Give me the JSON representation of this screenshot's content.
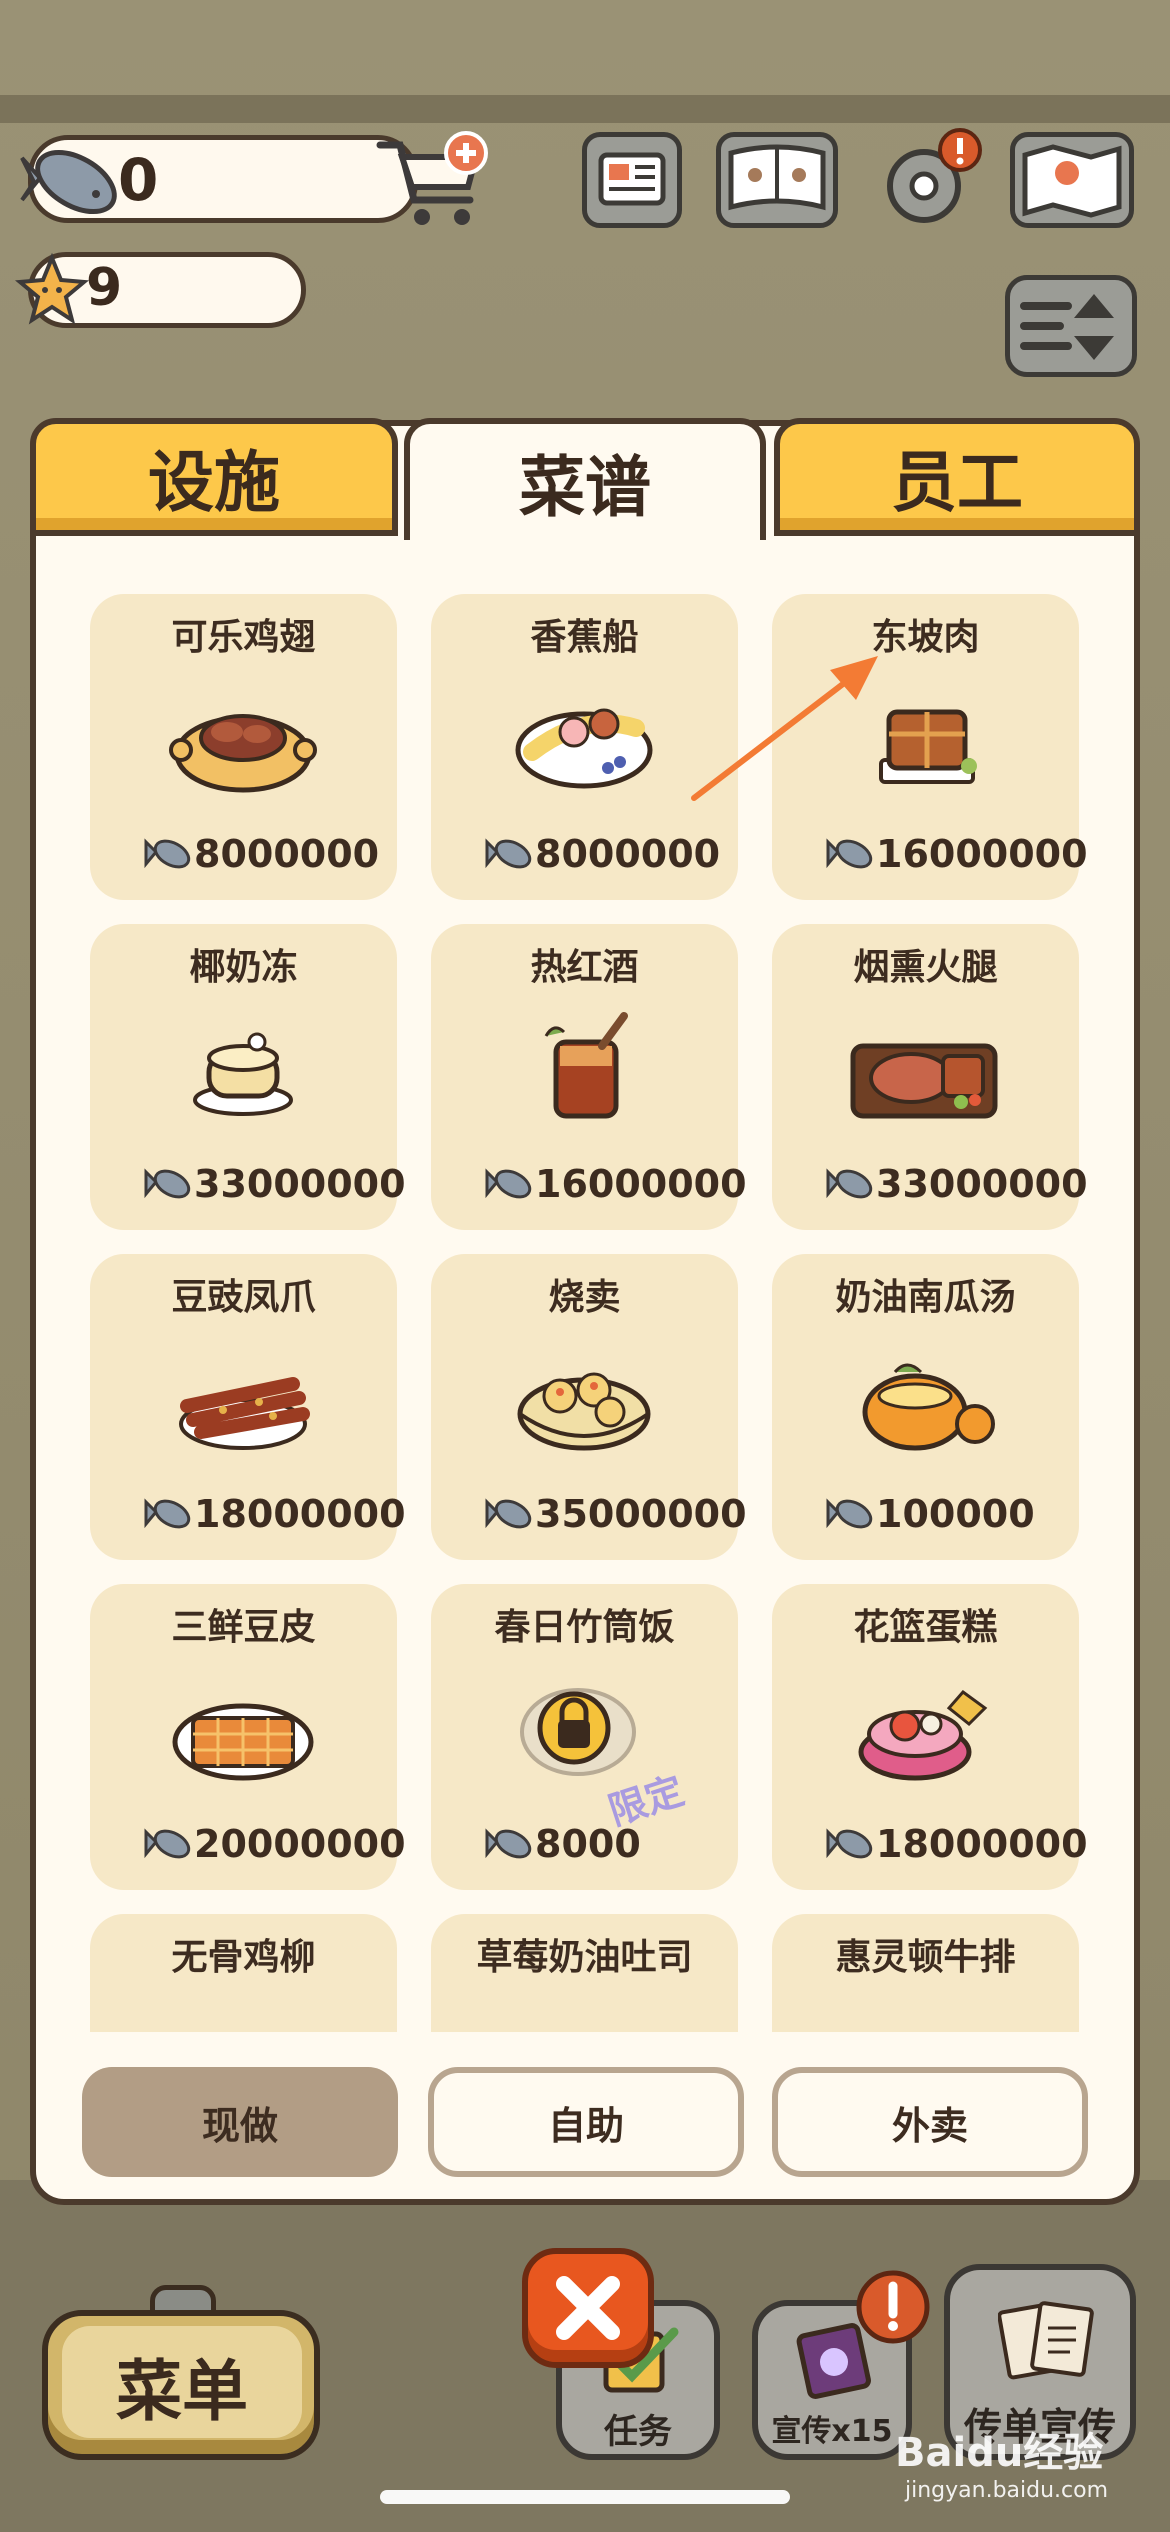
{
  "hud": {
    "fish_count": "0",
    "star_count": "9"
  },
  "tabs": [
    {
      "label": "设施",
      "active": false
    },
    {
      "label": "菜谱",
      "active": true
    },
    {
      "label": "员工",
      "active": false
    }
  ],
  "recipes": [
    {
      "name": "可乐鸡翅",
      "price": "8000000"
    },
    {
      "name": "香蕉船",
      "price": "8000000"
    },
    {
      "name": "东坡肉",
      "price": "16000000"
    },
    {
      "name": "椰奶冻",
      "price": "33000000"
    },
    {
      "name": "热红酒",
      "price": "16000000"
    },
    {
      "name": "烟熏火腿",
      "price": "33000000"
    },
    {
      "name": "豆豉凤爪",
      "price": "18000000"
    },
    {
      "name": "烧卖",
      "price": "35000000"
    },
    {
      "name": "奶油南瓜汤",
      "price": "100000"
    },
    {
      "name": "三鲜豆皮",
      "price": "20000000"
    },
    {
      "name": "春日竹筒饭",
      "price": "8000",
      "locked": true,
      "badge": "限定"
    },
    {
      "name": "花篮蛋糕",
      "price": "18000000"
    },
    {
      "name": "无骨鸡柳",
      "price": ""
    },
    {
      "name": "草莓奶油吐司",
      "price": ""
    },
    {
      "name": "惠灵顿牛排",
      "price": ""
    }
  ],
  "service_options": [
    {
      "label": "现做",
      "selected": true
    },
    {
      "label": "自助",
      "selected": false
    },
    {
      "label": "外卖",
      "selected": false
    }
  ],
  "bottom": {
    "menu_label": "菜单",
    "task_label": "任务",
    "promo_label": "宣传x15",
    "flyer_label": "传单宣传"
  },
  "watermark": {
    "brand": "Baidu经验",
    "url": "jingyan.baidu.com"
  },
  "colors": {
    "tab_yellow": "#fdc84a",
    "card_bg": "#f6e8c7",
    "panel_bg": "#fffaf0",
    "outline": "#4b3a2c",
    "selected_option": "#b29d85",
    "close_orange": "#e8571f"
  }
}
